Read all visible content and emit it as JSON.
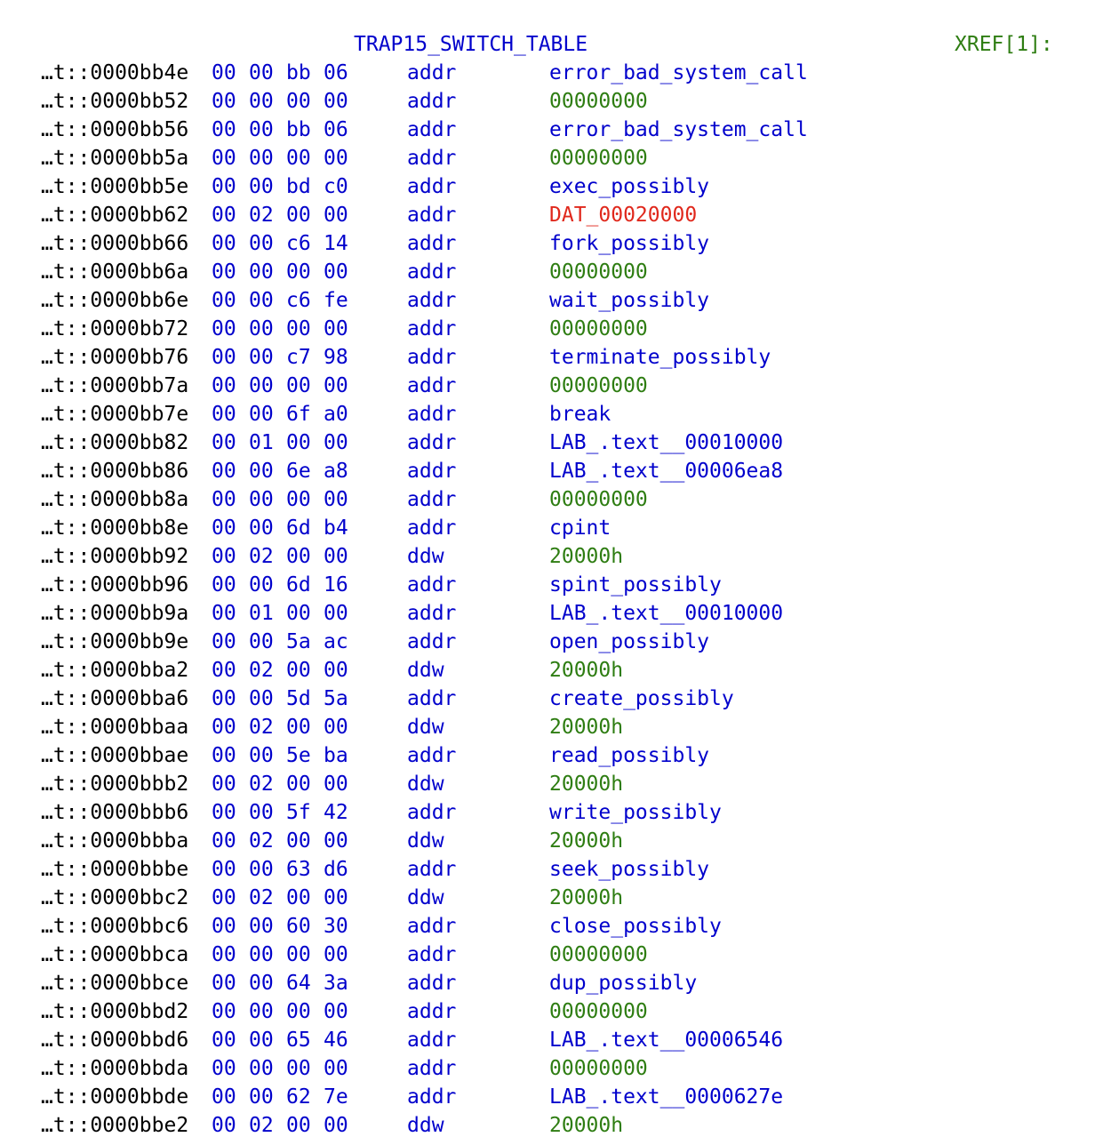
{
  "colors": {
    "address": "#000000",
    "bytes": "#0000cc",
    "mnemonic": "#0000cc",
    "label": "#0000cc",
    "symbol": "#0000cc",
    "value": "#2e7d12",
    "bad_ref": "#e0281c",
    "xref": "#2e7d12"
  },
  "header": {
    "label": "TRAP15_SWITCH_TABLE",
    "xref": "XREF[1]:"
  },
  "rows": [
    {
      "address": "…t::0000bb4e",
      "bytes": [
        "00",
        "00",
        "bb",
        "06"
      ],
      "mnemonic": "addr",
      "operand": "error_bad_system_call",
      "kind": "symbol"
    },
    {
      "address": "…t::0000bb52",
      "bytes": [
        "00",
        "00",
        "00",
        "00"
      ],
      "mnemonic": "addr",
      "operand": "00000000",
      "kind": "value"
    },
    {
      "address": "…t::0000bb56",
      "bytes": [
        "00",
        "00",
        "bb",
        "06"
      ],
      "mnemonic": "addr",
      "operand": "error_bad_system_call",
      "kind": "symbol"
    },
    {
      "address": "…t::0000bb5a",
      "bytes": [
        "00",
        "00",
        "00",
        "00"
      ],
      "mnemonic": "addr",
      "operand": "00000000",
      "kind": "value"
    },
    {
      "address": "…t::0000bb5e",
      "bytes": [
        "00",
        "00",
        "bd",
        "c0"
      ],
      "mnemonic": "addr",
      "operand": "exec_possibly",
      "kind": "symbol"
    },
    {
      "address": "…t::0000bb62",
      "bytes": [
        "00",
        "02",
        "00",
        "00"
      ],
      "mnemonic": "addr",
      "operand": "DAT_00020000",
      "kind": "bad_ref"
    },
    {
      "address": "…t::0000bb66",
      "bytes": [
        "00",
        "00",
        "c6",
        "14"
      ],
      "mnemonic": "addr",
      "operand": "fork_possibly",
      "kind": "symbol"
    },
    {
      "address": "…t::0000bb6a",
      "bytes": [
        "00",
        "00",
        "00",
        "00"
      ],
      "mnemonic": "addr",
      "operand": "00000000",
      "kind": "value"
    },
    {
      "address": "…t::0000bb6e",
      "bytes": [
        "00",
        "00",
        "c6",
        "fe"
      ],
      "mnemonic": "addr",
      "operand": "wait_possibly",
      "kind": "symbol"
    },
    {
      "address": "…t::0000bb72",
      "bytes": [
        "00",
        "00",
        "00",
        "00"
      ],
      "mnemonic": "addr",
      "operand": "00000000",
      "kind": "value"
    },
    {
      "address": "…t::0000bb76",
      "bytes": [
        "00",
        "00",
        "c7",
        "98"
      ],
      "mnemonic": "addr",
      "operand": "terminate_possibly",
      "kind": "symbol"
    },
    {
      "address": "…t::0000bb7a",
      "bytes": [
        "00",
        "00",
        "00",
        "00"
      ],
      "mnemonic": "addr",
      "operand": "00000000",
      "kind": "value"
    },
    {
      "address": "…t::0000bb7e",
      "bytes": [
        "00",
        "00",
        "6f",
        "a0"
      ],
      "mnemonic": "addr",
      "operand": "break",
      "kind": "symbol"
    },
    {
      "address": "…t::0000bb82",
      "bytes": [
        "00",
        "01",
        "00",
        "00"
      ],
      "mnemonic": "addr",
      "operand": "LAB_.text__00010000",
      "kind": "symbol"
    },
    {
      "address": "…t::0000bb86",
      "bytes": [
        "00",
        "00",
        "6e",
        "a8"
      ],
      "mnemonic": "addr",
      "operand": "LAB_.text__00006ea8",
      "kind": "symbol"
    },
    {
      "address": "…t::0000bb8a",
      "bytes": [
        "00",
        "00",
        "00",
        "00"
      ],
      "mnemonic": "addr",
      "operand": "00000000",
      "kind": "value"
    },
    {
      "address": "…t::0000bb8e",
      "bytes": [
        "00",
        "00",
        "6d",
        "b4"
      ],
      "mnemonic": "addr",
      "operand": "cpint",
      "kind": "symbol"
    },
    {
      "address": "…t::0000bb92",
      "bytes": [
        "00",
        "02",
        "00",
        "00"
      ],
      "mnemonic": "ddw",
      "operand": "20000h",
      "kind": "value"
    },
    {
      "address": "…t::0000bb96",
      "bytes": [
        "00",
        "00",
        "6d",
        "16"
      ],
      "mnemonic": "addr",
      "operand": "spint_possibly",
      "kind": "symbol"
    },
    {
      "address": "…t::0000bb9a",
      "bytes": [
        "00",
        "01",
        "00",
        "00"
      ],
      "mnemonic": "addr",
      "operand": "LAB_.text__00010000",
      "kind": "symbol"
    },
    {
      "address": "…t::0000bb9e",
      "bytes": [
        "00",
        "00",
        "5a",
        "ac"
      ],
      "mnemonic": "addr",
      "operand": "open_possibly",
      "kind": "symbol"
    },
    {
      "address": "…t::0000bba2",
      "bytes": [
        "00",
        "02",
        "00",
        "00"
      ],
      "mnemonic": "ddw",
      "operand": "20000h",
      "kind": "value"
    },
    {
      "address": "…t::0000bba6",
      "bytes": [
        "00",
        "00",
        "5d",
        "5a"
      ],
      "mnemonic": "addr",
      "operand": "create_possibly",
      "kind": "symbol"
    },
    {
      "address": "…t::0000bbaa",
      "bytes": [
        "00",
        "02",
        "00",
        "00"
      ],
      "mnemonic": "ddw",
      "operand": "20000h",
      "kind": "value"
    },
    {
      "address": "…t::0000bbae",
      "bytes": [
        "00",
        "00",
        "5e",
        "ba"
      ],
      "mnemonic": "addr",
      "operand": "read_possibly",
      "kind": "symbol"
    },
    {
      "address": "…t::0000bbb2",
      "bytes": [
        "00",
        "02",
        "00",
        "00"
      ],
      "mnemonic": "ddw",
      "operand": "20000h",
      "kind": "value"
    },
    {
      "address": "…t::0000bbb6",
      "bytes": [
        "00",
        "00",
        "5f",
        "42"
      ],
      "mnemonic": "addr",
      "operand": "write_possibly",
      "kind": "symbol"
    },
    {
      "address": "…t::0000bbba",
      "bytes": [
        "00",
        "02",
        "00",
        "00"
      ],
      "mnemonic": "ddw",
      "operand": "20000h",
      "kind": "value"
    },
    {
      "address": "…t::0000bbbe",
      "bytes": [
        "00",
        "00",
        "63",
        "d6"
      ],
      "mnemonic": "addr",
      "operand": "seek_possibly",
      "kind": "symbol"
    },
    {
      "address": "…t::0000bbc2",
      "bytes": [
        "00",
        "02",
        "00",
        "00"
      ],
      "mnemonic": "ddw",
      "operand": "20000h",
      "kind": "value"
    },
    {
      "address": "…t::0000bbc6",
      "bytes": [
        "00",
        "00",
        "60",
        "30"
      ],
      "mnemonic": "addr",
      "operand": "close_possibly",
      "kind": "symbol"
    },
    {
      "address": "…t::0000bbca",
      "bytes": [
        "00",
        "00",
        "00",
        "00"
      ],
      "mnemonic": "addr",
      "operand": "00000000",
      "kind": "value"
    },
    {
      "address": "…t::0000bbce",
      "bytes": [
        "00",
        "00",
        "64",
        "3a"
      ],
      "mnemonic": "addr",
      "operand": "dup_possibly",
      "kind": "symbol"
    },
    {
      "address": "…t::0000bbd2",
      "bytes": [
        "00",
        "00",
        "00",
        "00"
      ],
      "mnemonic": "addr",
      "operand": "00000000",
      "kind": "value"
    },
    {
      "address": "…t::0000bbd6",
      "bytes": [
        "00",
        "00",
        "65",
        "46"
      ],
      "mnemonic": "addr",
      "operand": "LAB_.text__00006546",
      "kind": "symbol"
    },
    {
      "address": "…t::0000bbda",
      "bytes": [
        "00",
        "00",
        "00",
        "00"
      ],
      "mnemonic": "addr",
      "operand": "00000000",
      "kind": "value"
    },
    {
      "address": "…t::0000bbde",
      "bytes": [
        "00",
        "00",
        "62",
        "7e"
      ],
      "mnemonic": "addr",
      "operand": "LAB_.text__0000627e",
      "kind": "symbol"
    },
    {
      "address": "…t::0000bbe2",
      "bytes": [
        "00",
        "02",
        "00",
        "00"
      ],
      "mnemonic": "ddw",
      "operand": "20000h",
      "kind": "value"
    }
  ]
}
